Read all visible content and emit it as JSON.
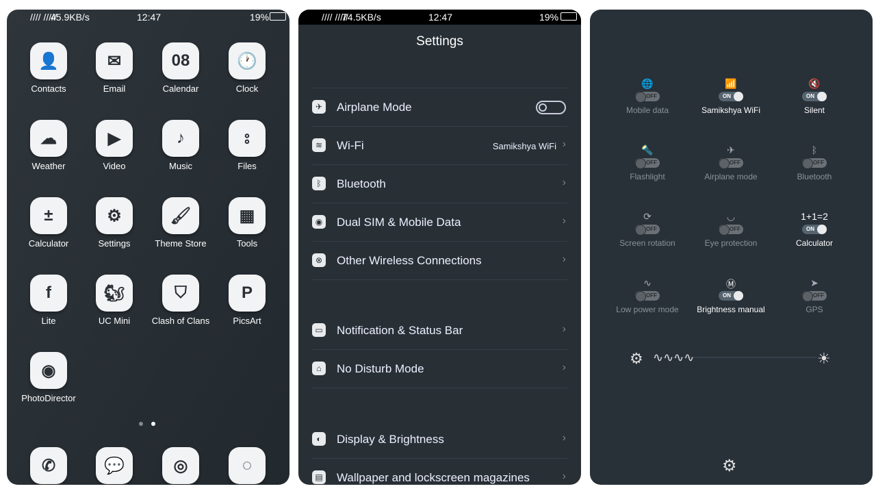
{
  "home": {
    "status": {
      "signal": "//// /////",
      "speed": "45.9KB/s",
      "time": "12:47",
      "battery": "19%"
    },
    "apps": [
      {
        "label": "Contacts",
        "glyph": "👤"
      },
      {
        "label": "Email",
        "glyph": "✉"
      },
      {
        "label": "Calendar",
        "glyph": "08"
      },
      {
        "label": "Clock",
        "glyph": "🕐"
      },
      {
        "label": "Weather",
        "glyph": "☁"
      },
      {
        "label": "Video",
        "glyph": "▶"
      },
      {
        "label": "Music",
        "glyph": "♪"
      },
      {
        "label": "Files",
        "glyph": "⦂"
      },
      {
        "label": "Calculator",
        "glyph": "±"
      },
      {
        "label": "Settings",
        "glyph": "⚙"
      },
      {
        "label": "Theme Store",
        "glyph": "🖌"
      },
      {
        "label": "Tools",
        "glyph": "▦"
      },
      {
        "label": "Lite",
        "glyph": "f"
      },
      {
        "label": "UC Mini",
        "glyph": "🐿"
      },
      {
        "label": "Clash of Clans",
        "glyph": "⛉"
      },
      {
        "label": "PicsArt",
        "glyph": "P"
      },
      {
        "label": "PhotoDirector",
        "glyph": "◉"
      }
    ],
    "dock": [
      {
        "name": "phone",
        "glyph": "✆"
      },
      {
        "name": "messages",
        "glyph": "💬"
      },
      {
        "name": "camera",
        "glyph": "◎"
      },
      {
        "name": "browser",
        "glyph": "◌"
      }
    ],
    "page_count": 2,
    "current_page": 2
  },
  "settings": {
    "status": {
      "signal": "//// /////",
      "speed": "74.5KB/s",
      "time": "12:47",
      "battery": "19%"
    },
    "title": "Settings",
    "items": [
      {
        "label": "Airplane Mode",
        "icon": "airplane-icon",
        "glyph": "✈",
        "toggle": false
      },
      {
        "label": "Wi-Fi",
        "icon": "wifi-icon",
        "glyph": "≋",
        "value": "Samikshya WiFi"
      },
      {
        "label": "Bluetooth",
        "icon": "bluetooth-icon",
        "glyph": "ᛒ"
      },
      {
        "label": "Dual SIM & Mobile Data",
        "icon": "sim-icon",
        "glyph": "◉"
      },
      {
        "label": "Other Wireless Connections",
        "icon": "wireless-icon",
        "glyph": "⊗"
      },
      {
        "label": "Notification & Status Bar",
        "icon": "notification-icon",
        "glyph": "▭"
      },
      {
        "label": "No Disturb Mode",
        "icon": "home-icon",
        "glyph": "⌂"
      },
      {
        "label": "Display & Brightness",
        "icon": "display-icon",
        "glyph": "◐"
      },
      {
        "label": "Wallpaper and lockscreen magazines",
        "icon": "wallpaper-icon",
        "glyph": "▤"
      }
    ]
  },
  "control_center": {
    "tiles": [
      {
        "label": "Mobile data",
        "icon": "globe-icon",
        "glyph": "🌐",
        "on": false
      },
      {
        "label": "Samikshya WiFi",
        "icon": "wifi-icon",
        "glyph": "📶",
        "on": true
      },
      {
        "label": "Silent",
        "icon": "mute-icon",
        "glyph": "🔇",
        "on": true
      },
      {
        "label": "Flashlight",
        "icon": "flashlight-icon",
        "glyph": "🔦",
        "on": false
      },
      {
        "label": "Airplane mode",
        "icon": "airplane-icon",
        "glyph": "✈",
        "on": false
      },
      {
        "label": "Bluetooth",
        "icon": "bluetooth-icon",
        "glyph": "ᛒ",
        "on": false
      },
      {
        "label": "Screen rotation",
        "icon": "rotation-icon",
        "glyph": "⟳",
        "on": false
      },
      {
        "label": "Eye protection",
        "icon": "eye-icon",
        "glyph": "◡",
        "on": false
      },
      {
        "label": "Calculator",
        "icon": "calculator-icon",
        "glyph": "1+1=2",
        "on": true
      },
      {
        "label": "Low power mode",
        "icon": "pulse-icon",
        "glyph": "∿",
        "on": false
      },
      {
        "label": "Brightness manual",
        "icon": "brightness-manual-icon",
        "glyph": "Ⓜ",
        "on": true
      },
      {
        "label": "GPS",
        "icon": "gps-icon",
        "glyph": "➤",
        "on": false
      }
    ],
    "on_label": "ON",
    "off_label": "OFF",
    "brightness_level": 0.25
  }
}
